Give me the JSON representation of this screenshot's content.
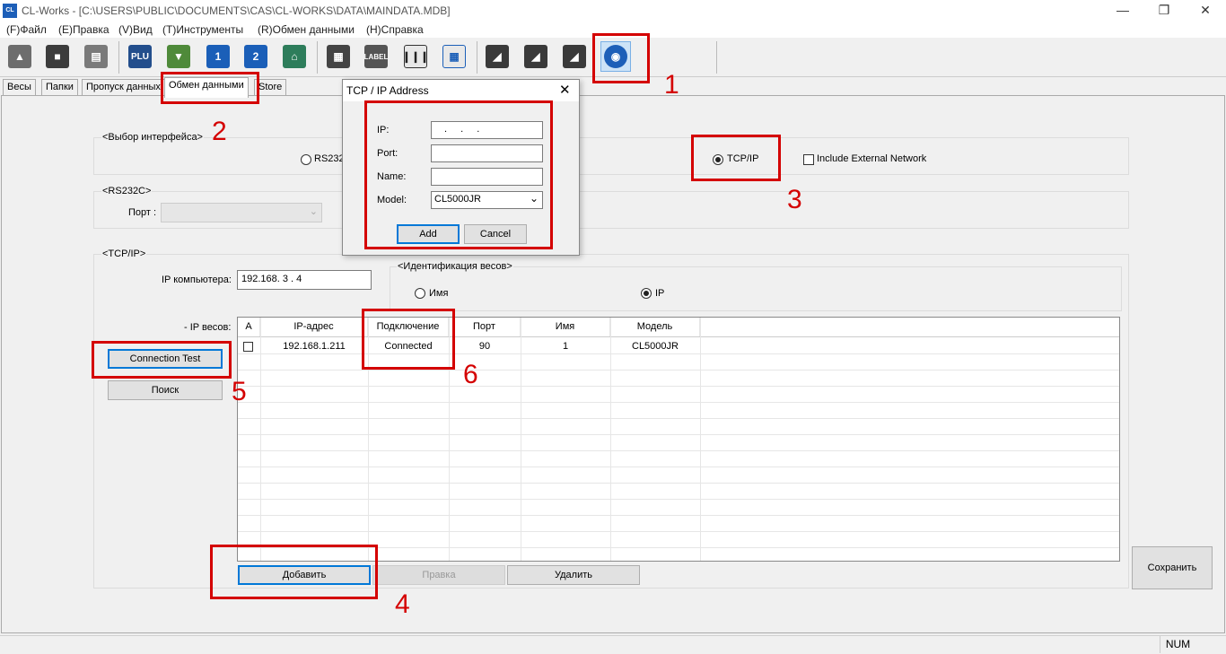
{
  "window": {
    "title": "CL-Works - [C:\\USERS\\PUBLIC\\DOCUMENTS\\CAS\\CL-WORKS\\DATA\\MAINDATA.MDB]",
    "icon_text": "CL"
  },
  "menu": [
    "(F)Файл",
    "(E)Правка",
    "(V)Вид",
    "(T)Инструменты",
    "(R)Обмен данными",
    "(H)Справка"
  ],
  "toolbar": {
    "icons": [
      "open-folder-icon",
      "save-icon",
      "print-icon",
      "plu-icon",
      "download-icon",
      "scale-1-icon",
      "scale-2-icon",
      "store-icon",
      "scale-device-icon",
      "label-icon",
      "barcode-icon",
      "table-icon",
      "send-1-icon",
      "send-2-icon",
      "send-3-icon",
      "settings-eye-icon"
    ],
    "plu_text": "PLU",
    "n1": "1",
    "n2": "2",
    "label_text": "LABEL"
  },
  "tabs": [
    "Весы",
    "Папки",
    "Пропуск данных",
    "Обмен данными",
    "Store"
  ],
  "interface_group": {
    "title": "<Выбор интерфейса>",
    "rs232": "RS232",
    "tcpip": "TCP/IP",
    "include_external": "Include External Network"
  },
  "rs232_group": {
    "title": "<RS232C>",
    "port_label": "Порт :"
  },
  "tcpip_group": {
    "title": "<TCP/IP>",
    "pc_ip_label": "IP компьютера:",
    "pc_ip_value": "192.168.  3  .  4",
    "ident_title": "<Идентификация весов>",
    "ident_name": "Имя",
    "ident_ip": "IP",
    "scale_ip_label": "- IP весов:"
  },
  "table": {
    "headers": [
      "A",
      "IP-адрес",
      "Подключение",
      "Порт",
      "Имя",
      "Модель"
    ],
    "rows": [
      {
        "ip": "192.168.1.211",
        "status": "Connected",
        "port": "90",
        "name": "1",
        "model": "CL5000JR"
      }
    ]
  },
  "buttons": {
    "connection_test": "Connection Test",
    "search": "Поиск",
    "add": "Добавить",
    "edit": "Правка",
    "delete": "Удалить",
    "save": "Сохранить"
  },
  "dialog": {
    "title": "TCP / IP Address",
    "ip_label": "IP:",
    "ip_value": "  .   .   .",
    "port_label": "Port:",
    "name_label": "Name:",
    "model_label": "Model:",
    "model_value": "CL5000JR",
    "add": "Add",
    "cancel": "Cancel"
  },
  "annotations": [
    "1",
    "2",
    "3",
    "4",
    "5",
    "6"
  ],
  "status": {
    "num": "NUM"
  }
}
